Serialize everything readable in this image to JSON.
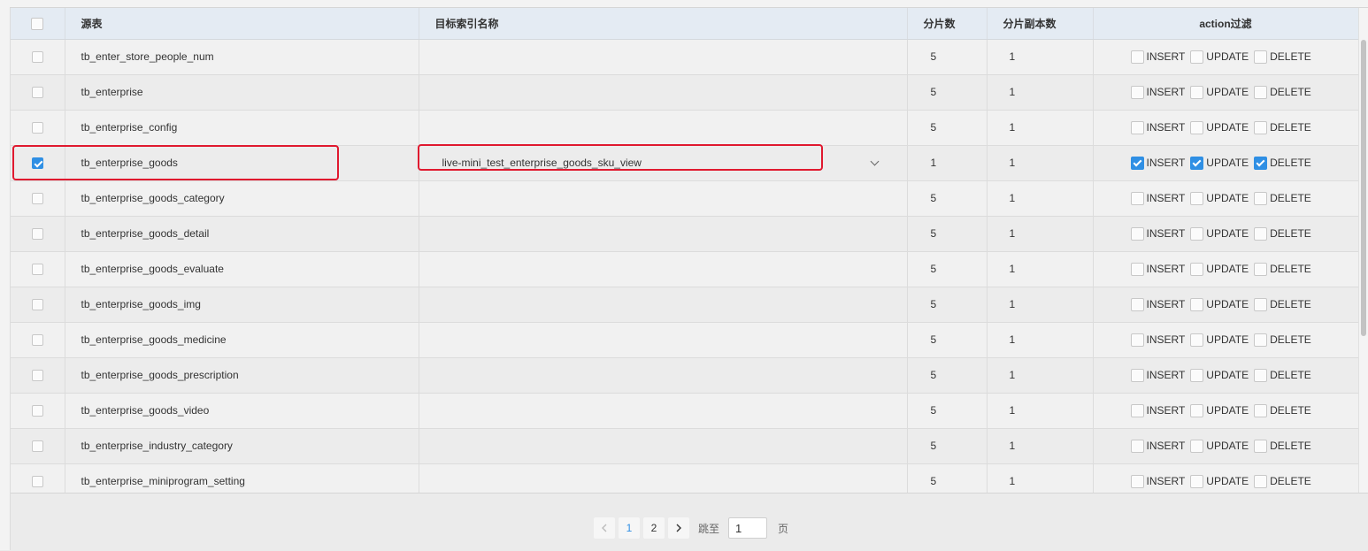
{
  "table": {
    "columns": {
      "source": "源表",
      "target_index": "目标索引名称",
      "shards": "分片数",
      "replicas": "分片副本数",
      "action_filter": "action过滤"
    },
    "rows": [
      {
        "checked": false,
        "source": "tb_enter_store_people_num",
        "target_index": "",
        "shards": "5",
        "replicas": "1",
        "insert": false,
        "update": false,
        "delete": false
      },
      {
        "checked": false,
        "source": "tb_enterprise",
        "target_index": "",
        "shards": "5",
        "replicas": "1",
        "insert": false,
        "update": false,
        "delete": false
      },
      {
        "checked": false,
        "source": "tb_enterprise_config",
        "target_index": "",
        "shards": "5",
        "replicas": "1",
        "insert": false,
        "update": false,
        "delete": false
      },
      {
        "checked": true,
        "source": "tb_enterprise_goods",
        "target_index": "live-mini_test_enterprise_goods_sku_view",
        "shards": "1",
        "replicas": "1",
        "insert": true,
        "update": true,
        "delete": true
      },
      {
        "checked": false,
        "source": "tb_enterprise_goods_category",
        "target_index": "",
        "shards": "5",
        "replicas": "1",
        "insert": false,
        "update": false,
        "delete": false
      },
      {
        "checked": false,
        "source": "tb_enterprise_goods_detail",
        "target_index": "",
        "shards": "5",
        "replicas": "1",
        "insert": false,
        "update": false,
        "delete": false
      },
      {
        "checked": false,
        "source": "tb_enterprise_goods_evaluate",
        "target_index": "",
        "shards": "5",
        "replicas": "1",
        "insert": false,
        "update": false,
        "delete": false
      },
      {
        "checked": false,
        "source": "tb_enterprise_goods_img",
        "target_index": "",
        "shards": "5",
        "replicas": "1",
        "insert": false,
        "update": false,
        "delete": false
      },
      {
        "checked": false,
        "source": "tb_enterprise_goods_medicine",
        "target_index": "",
        "shards": "5",
        "replicas": "1",
        "insert": false,
        "update": false,
        "delete": false
      },
      {
        "checked": false,
        "source": "tb_enterprise_goods_prescription",
        "target_index": "",
        "shards": "5",
        "replicas": "1",
        "insert": false,
        "update": false,
        "delete": false
      },
      {
        "checked": false,
        "source": "tb_enterprise_goods_video",
        "target_index": "",
        "shards": "5",
        "replicas": "1",
        "insert": false,
        "update": false,
        "delete": false
      },
      {
        "checked": false,
        "source": "tb_enterprise_industry_category",
        "target_index": "",
        "shards": "5",
        "replicas": "1",
        "insert": false,
        "update": false,
        "delete": false
      },
      {
        "checked": false,
        "source": "tb_enterprise_miniprogram_setting",
        "target_index": "",
        "shards": "5",
        "replicas": "1",
        "insert": false,
        "update": false,
        "delete": false
      }
    ]
  },
  "actions": {
    "insert": "INSERT",
    "update": "UPDATE",
    "delete": "DELETE"
  },
  "pagination": {
    "prev_icon": "chevron-left-icon",
    "next_icon": "chevron-right-icon",
    "pages": [
      "1",
      "2"
    ],
    "current_page": "1",
    "jump_label": "跳至",
    "jump_value": "1",
    "page_suffix": "页"
  },
  "colors": {
    "accent": "#2f8fe4",
    "highlight": "#e0192f"
  }
}
